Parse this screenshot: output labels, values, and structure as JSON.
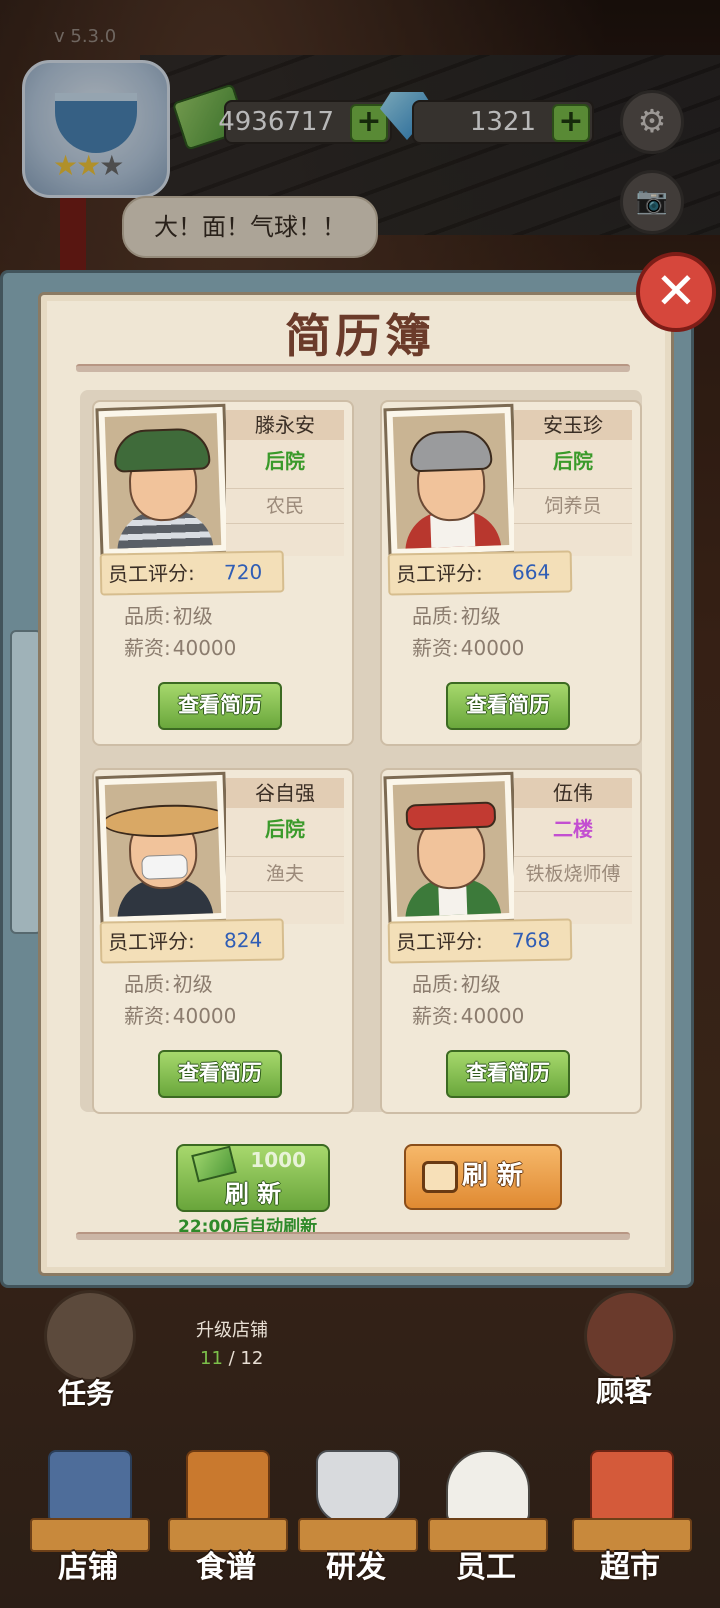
{
  "hud": {
    "version": "v 5.3.0",
    "cash": "4936717",
    "gems": "1321",
    "plus": "+",
    "speech": "大！面！气球！！",
    "stars_on": "★★",
    "stars_off": "★"
  },
  "icons": {
    "settings": "⚙",
    "camera": "📷",
    "close": "✕"
  },
  "modal": {
    "title": "简历簿",
    "cards": [
      {
        "name": "滕永安",
        "location": "后院",
        "location_color": "#3a9a2a",
        "job": "农民",
        "score_label": "员工评分:",
        "score": "720",
        "quality_label": "品质:",
        "quality": "初级",
        "salary_label": "薪资:",
        "salary": "40000",
        "button": "查看简历"
      },
      {
        "name": "安玉珍",
        "location": "后院",
        "location_color": "#3a9a2a",
        "job": "饲养员",
        "score_label": "员工评分:",
        "score": "664",
        "quality_label": "品质:",
        "quality": "初级",
        "salary_label": "薪资:",
        "salary": "40000",
        "button": "查看简历"
      },
      {
        "name": "谷自强",
        "location": "后院",
        "location_color": "#3a9a2a",
        "job": "渔夫",
        "score_label": "员工评分:",
        "score": "824",
        "quality_label": "品质:",
        "quality": "初级",
        "salary_label": "薪资:",
        "salary": "40000",
        "button": "查看简历"
      },
      {
        "name": "伍伟",
        "location": "二楼",
        "location_color": "#c34fd1",
        "job": "铁板烧师傅",
        "score_label": "员工评分:",
        "score": "768",
        "quality_label": "品质:",
        "quality": "初级",
        "salary_label": "薪资:",
        "salary": "40000",
        "button": "查看简历"
      }
    ],
    "refresh_cost": "1000",
    "refresh_label": "刷 新",
    "auto_refresh": "22:00后自动刷新",
    "refresh_ad_label": "刷 新"
  },
  "bottom": {
    "upgrade_label": "升级店铺",
    "upgrade_current": "11",
    "upgrade_sep": " / ",
    "upgrade_total": "12",
    "task_label": "任务",
    "customer_label": "顾客",
    "nav": [
      "店铺",
      "食谱",
      "研发",
      "员工",
      "超市"
    ]
  }
}
